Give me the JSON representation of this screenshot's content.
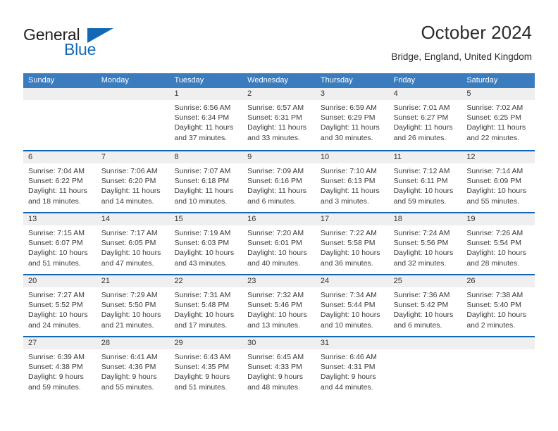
{
  "logo": {
    "word_one": "General",
    "word_two": "Blue",
    "triangle_icon": "triangle-icon",
    "accent_color": "#1268b3"
  },
  "header": {
    "title": "October 2024",
    "subtitle": "Bridge, England, United Kingdom"
  },
  "calendar": {
    "header_bg": "#3a7cbe",
    "row_divider_color": "#1268b3",
    "daynum_bg": "#efefef",
    "day_names": [
      "Sunday",
      "Monday",
      "Tuesday",
      "Wednesday",
      "Thursday",
      "Friday",
      "Saturday"
    ],
    "weeks": [
      [
        {
          "day": "",
          "sunrise": "",
          "sunset": "",
          "daylight_line1": "",
          "daylight_line2": ""
        },
        {
          "day": "",
          "sunrise": "",
          "sunset": "",
          "daylight_line1": "",
          "daylight_line2": ""
        },
        {
          "day": "1",
          "sunrise": "Sunrise: 6:56 AM",
          "sunset": "Sunset: 6:34 PM",
          "daylight_line1": "Daylight: 11 hours",
          "daylight_line2": "and 37 minutes."
        },
        {
          "day": "2",
          "sunrise": "Sunrise: 6:57 AM",
          "sunset": "Sunset: 6:31 PM",
          "daylight_line1": "Daylight: 11 hours",
          "daylight_line2": "and 33 minutes."
        },
        {
          "day": "3",
          "sunrise": "Sunrise: 6:59 AM",
          "sunset": "Sunset: 6:29 PM",
          "daylight_line1": "Daylight: 11 hours",
          "daylight_line2": "and 30 minutes."
        },
        {
          "day": "4",
          "sunrise": "Sunrise: 7:01 AM",
          "sunset": "Sunset: 6:27 PM",
          "daylight_line1": "Daylight: 11 hours",
          "daylight_line2": "and 26 minutes."
        },
        {
          "day": "5",
          "sunrise": "Sunrise: 7:02 AM",
          "sunset": "Sunset: 6:25 PM",
          "daylight_line1": "Daylight: 11 hours",
          "daylight_line2": "and 22 minutes."
        }
      ],
      [
        {
          "day": "6",
          "sunrise": "Sunrise: 7:04 AM",
          "sunset": "Sunset: 6:22 PM",
          "daylight_line1": "Daylight: 11 hours",
          "daylight_line2": "and 18 minutes."
        },
        {
          "day": "7",
          "sunrise": "Sunrise: 7:06 AM",
          "sunset": "Sunset: 6:20 PM",
          "daylight_line1": "Daylight: 11 hours",
          "daylight_line2": "and 14 minutes."
        },
        {
          "day": "8",
          "sunrise": "Sunrise: 7:07 AM",
          "sunset": "Sunset: 6:18 PM",
          "daylight_line1": "Daylight: 11 hours",
          "daylight_line2": "and 10 minutes."
        },
        {
          "day": "9",
          "sunrise": "Sunrise: 7:09 AM",
          "sunset": "Sunset: 6:16 PM",
          "daylight_line1": "Daylight: 11 hours",
          "daylight_line2": "and 6 minutes."
        },
        {
          "day": "10",
          "sunrise": "Sunrise: 7:10 AM",
          "sunset": "Sunset: 6:13 PM",
          "daylight_line1": "Daylight: 11 hours",
          "daylight_line2": "and 3 minutes."
        },
        {
          "day": "11",
          "sunrise": "Sunrise: 7:12 AM",
          "sunset": "Sunset: 6:11 PM",
          "daylight_line1": "Daylight: 10 hours",
          "daylight_line2": "and 59 minutes."
        },
        {
          "day": "12",
          "sunrise": "Sunrise: 7:14 AM",
          "sunset": "Sunset: 6:09 PM",
          "daylight_line1": "Daylight: 10 hours",
          "daylight_line2": "and 55 minutes."
        }
      ],
      [
        {
          "day": "13",
          "sunrise": "Sunrise: 7:15 AM",
          "sunset": "Sunset: 6:07 PM",
          "daylight_line1": "Daylight: 10 hours",
          "daylight_line2": "and 51 minutes."
        },
        {
          "day": "14",
          "sunrise": "Sunrise: 7:17 AM",
          "sunset": "Sunset: 6:05 PM",
          "daylight_line1": "Daylight: 10 hours",
          "daylight_line2": "and 47 minutes."
        },
        {
          "day": "15",
          "sunrise": "Sunrise: 7:19 AM",
          "sunset": "Sunset: 6:03 PM",
          "daylight_line1": "Daylight: 10 hours",
          "daylight_line2": "and 43 minutes."
        },
        {
          "day": "16",
          "sunrise": "Sunrise: 7:20 AM",
          "sunset": "Sunset: 6:01 PM",
          "daylight_line1": "Daylight: 10 hours",
          "daylight_line2": "and 40 minutes."
        },
        {
          "day": "17",
          "sunrise": "Sunrise: 7:22 AM",
          "sunset": "Sunset: 5:58 PM",
          "daylight_line1": "Daylight: 10 hours",
          "daylight_line2": "and 36 minutes."
        },
        {
          "day": "18",
          "sunrise": "Sunrise: 7:24 AM",
          "sunset": "Sunset: 5:56 PM",
          "daylight_line1": "Daylight: 10 hours",
          "daylight_line2": "and 32 minutes."
        },
        {
          "day": "19",
          "sunrise": "Sunrise: 7:26 AM",
          "sunset": "Sunset: 5:54 PM",
          "daylight_line1": "Daylight: 10 hours",
          "daylight_line2": "and 28 minutes."
        }
      ],
      [
        {
          "day": "20",
          "sunrise": "Sunrise: 7:27 AM",
          "sunset": "Sunset: 5:52 PM",
          "daylight_line1": "Daylight: 10 hours",
          "daylight_line2": "and 24 minutes."
        },
        {
          "day": "21",
          "sunrise": "Sunrise: 7:29 AM",
          "sunset": "Sunset: 5:50 PM",
          "daylight_line1": "Daylight: 10 hours",
          "daylight_line2": "and 21 minutes."
        },
        {
          "day": "22",
          "sunrise": "Sunrise: 7:31 AM",
          "sunset": "Sunset: 5:48 PM",
          "daylight_line1": "Daylight: 10 hours",
          "daylight_line2": "and 17 minutes."
        },
        {
          "day": "23",
          "sunrise": "Sunrise: 7:32 AM",
          "sunset": "Sunset: 5:46 PM",
          "daylight_line1": "Daylight: 10 hours",
          "daylight_line2": "and 13 minutes."
        },
        {
          "day": "24",
          "sunrise": "Sunrise: 7:34 AM",
          "sunset": "Sunset: 5:44 PM",
          "daylight_line1": "Daylight: 10 hours",
          "daylight_line2": "and 10 minutes."
        },
        {
          "day": "25",
          "sunrise": "Sunrise: 7:36 AM",
          "sunset": "Sunset: 5:42 PM",
          "daylight_line1": "Daylight: 10 hours",
          "daylight_line2": "and 6 minutes."
        },
        {
          "day": "26",
          "sunrise": "Sunrise: 7:38 AM",
          "sunset": "Sunset: 5:40 PM",
          "daylight_line1": "Daylight: 10 hours",
          "daylight_line2": "and 2 minutes."
        }
      ],
      [
        {
          "day": "27",
          "sunrise": "Sunrise: 6:39 AM",
          "sunset": "Sunset: 4:38 PM",
          "daylight_line1": "Daylight: 9 hours",
          "daylight_line2": "and 59 minutes."
        },
        {
          "day": "28",
          "sunrise": "Sunrise: 6:41 AM",
          "sunset": "Sunset: 4:36 PM",
          "daylight_line1": "Daylight: 9 hours",
          "daylight_line2": "and 55 minutes."
        },
        {
          "day": "29",
          "sunrise": "Sunrise: 6:43 AM",
          "sunset": "Sunset: 4:35 PM",
          "daylight_line1": "Daylight: 9 hours",
          "daylight_line2": "and 51 minutes."
        },
        {
          "day": "30",
          "sunrise": "Sunrise: 6:45 AM",
          "sunset": "Sunset: 4:33 PM",
          "daylight_line1": "Daylight: 9 hours",
          "daylight_line2": "and 48 minutes."
        },
        {
          "day": "31",
          "sunrise": "Sunrise: 6:46 AM",
          "sunset": "Sunset: 4:31 PM",
          "daylight_line1": "Daylight: 9 hours",
          "daylight_line2": "and 44 minutes."
        },
        {
          "day": "",
          "sunrise": "",
          "sunset": "",
          "daylight_line1": "",
          "daylight_line2": ""
        },
        {
          "day": "",
          "sunrise": "",
          "sunset": "",
          "daylight_line1": "",
          "daylight_line2": ""
        }
      ]
    ]
  }
}
